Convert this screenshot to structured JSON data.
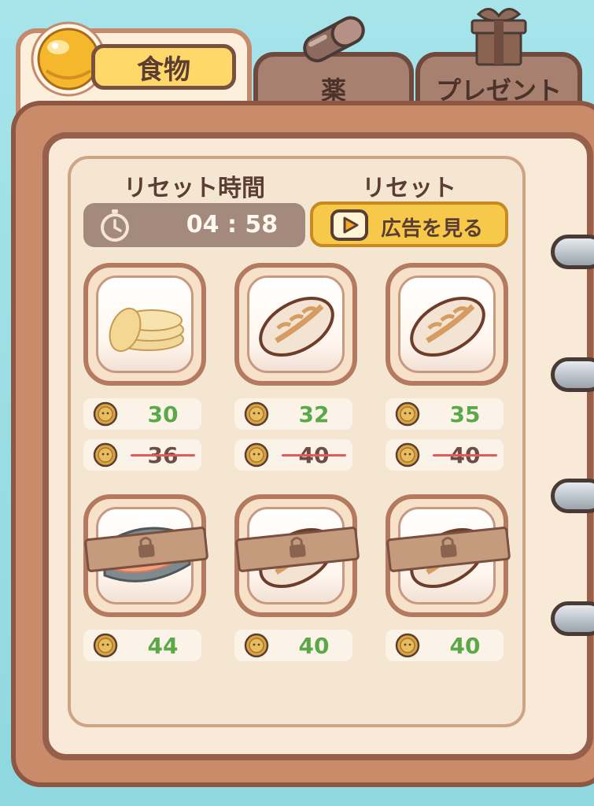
{
  "tabs": [
    {
      "label": "食物",
      "active": true,
      "icon": "cookie-icon"
    },
    {
      "label": "薬",
      "active": false,
      "icon": "capsule-icon"
    },
    {
      "label": "プレゼント",
      "active": false,
      "icon": "gift-box-icon"
    }
  ],
  "shop": {
    "reset_time_label": "リセット時間",
    "reset_label": "リセット",
    "timer": "04 : 58",
    "ad_button_label": "広告を見る"
  },
  "items": [
    {
      "name": "pancakes",
      "price": "30",
      "old_price": "36",
      "locked": false
    },
    {
      "name": "bread",
      "price": "32",
      "old_price": "40",
      "locked": false
    },
    {
      "name": "bread",
      "price": "35",
      "old_price": "40",
      "locked": false
    },
    {
      "name": "salmon",
      "price": "44",
      "locked": true
    },
    {
      "name": "bread",
      "price": "40",
      "locked": true
    },
    {
      "name": "bread",
      "price": "40",
      "locked": true
    }
  ],
  "colors": {
    "price_green": "#5aa847",
    "strike_red": "#e25b5b",
    "accent_yellow": "#f7c94b"
  }
}
